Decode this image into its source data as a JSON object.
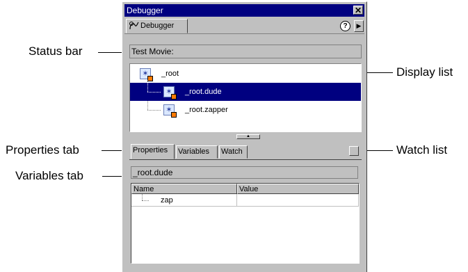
{
  "callouts": {
    "status_bar": "Status bar",
    "display_list": "Display list",
    "properties_tab": "Properties tab",
    "watch_list": "Watch list",
    "variables_tab": "Variables tab"
  },
  "panel": {
    "title": "Debugger",
    "close_glyph": "✕",
    "tab_label": "Debugger",
    "help_glyph": "?",
    "menu_glyph": "▶",
    "status_text": "Test Movie:",
    "display_list": [
      {
        "label": "_root",
        "selected": false
      },
      {
        "label": "_root.dude",
        "selected": true
      },
      {
        "label": "_root.zapper",
        "selected": false
      }
    ],
    "splitter_glyph": "▲",
    "subtabs": {
      "properties": "Properties",
      "variables": "Variables",
      "watch": "Watch"
    },
    "path_value": "_root.dude",
    "grid": {
      "columns": [
        "Name",
        "Value"
      ],
      "rows": [
        {
          "name": "zap",
          "value": ""
        }
      ]
    }
  },
  "colors": {
    "selection": "#000080",
    "panel_bg": "#c0c0c0"
  },
  "icons": {
    "panel_tab_icon": "debugger-icon",
    "movie_clip_icon": "movie-clip-icon"
  }
}
